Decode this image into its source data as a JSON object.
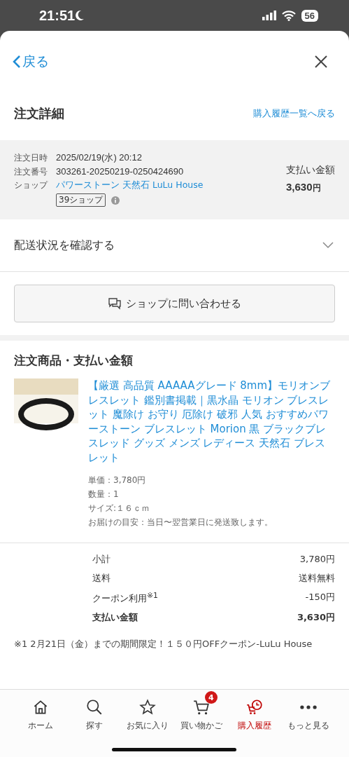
{
  "status_bar": {
    "time": "21:51",
    "battery": "56"
  },
  "header": {
    "back": "戻る"
  },
  "title_row": {
    "title": "注文詳細",
    "link": "購入履歴一覧へ戻る"
  },
  "order_info": {
    "rows": [
      {
        "label": "注文日時",
        "value": "2025/02/19(水) 20:12",
        "kind": "text"
      },
      {
        "label": "注文番号",
        "value": "303261-20250219-0250424690",
        "kind": "text"
      },
      {
        "label": "ショップ",
        "value": "パワーストーン 天然石 LuLu House",
        "kind": "link"
      }
    ],
    "shop_badge": "39ショップ",
    "payment_label": "支払い金額",
    "payment_amount": "3,630",
    "payment_unit": "円"
  },
  "delivery": {
    "label": "配送状況を確認する",
    "expanded": false
  },
  "contact_button": "ショップに問い合わせる",
  "items_section": {
    "title": "注文商品・支払い金額",
    "product": {
      "name": "【厳選 高品質 AAAAAグレード 8mm】モリオンブレスレット 鑑別書掲載｜黒水晶 モリオン ブレスレット 魔除け お守り 厄除け 破邪 人気 おすすめパワーストーン ブレスレット Morion 黒 ブラックブレスレッド グッズ メンズ レディース 天然石 ブレスレット",
      "details": [
        "単価：3,780円",
        "数量：1",
        "サイズ:１６ｃｍ",
        "お届けの目安：当日〜翌営業日に発送致します。"
      ]
    },
    "totals": [
      {
        "label": "小計",
        "value": "3,780円",
        "bold": false
      },
      {
        "label": "送料",
        "value": "送料無料",
        "bold": false
      },
      {
        "label": "クーポン利用$^{※1}$",
        "value": "-150円",
        "bold": false
      },
      {
        "label": "支払い金額",
        "value": "3,630円",
        "bold": true
      }
    ],
    "note": "※1 2月21日（金）までの期間限定！１５０円OFFクーポン-LuLu House"
  },
  "tab_bar": [
    {
      "label": "ホーム",
      "selected": false
    },
    {
      "label": "探す",
      "selected": false
    },
    {
      "label": "お気に入り",
      "selected": false
    },
    {
      "label": "買い物かご",
      "selected": false,
      "badge": "4"
    },
    {
      "label": "購入履歴",
      "selected": true
    },
    {
      "label": "もっと見る",
      "selected": false
    }
  ]
}
